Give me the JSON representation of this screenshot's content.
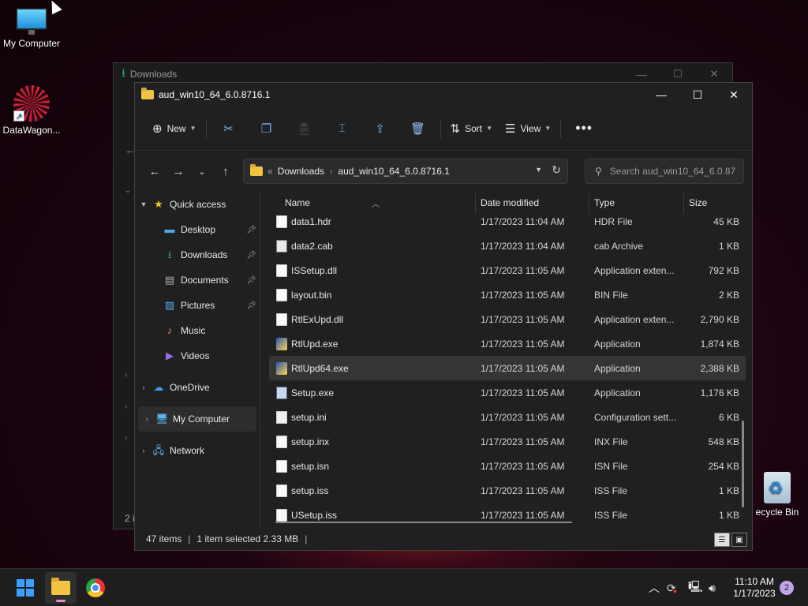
{
  "desktop": {
    "icons": [
      {
        "label": "My Computer",
        "icon": "monitor-icon"
      },
      {
        "label": "DataWagon...",
        "icon": "datawagon-icon"
      },
      {
        "label": "ecycle Bin",
        "icon": "recycle-bin-icon"
      }
    ]
  },
  "back_window": {
    "title": "Downloads",
    "status": "2 i",
    "controls": {
      "minimize": "—",
      "maximize": "☐",
      "close": "✕"
    }
  },
  "window": {
    "title": "aud_win10_64_6.0.8716.1",
    "controls": {
      "minimize": "—",
      "maximize": "☐",
      "close": "✕"
    }
  },
  "toolbar": {
    "new_label": "New",
    "sort_label": "Sort",
    "view_label": "View",
    "more_label": "•••",
    "icons": [
      "plus-icon",
      "cut-icon",
      "copy-icon",
      "paste-icon",
      "rename-icon",
      "share-icon",
      "delete-icon",
      "sort-icon",
      "view-icon",
      "more-icon"
    ]
  },
  "navigation": {
    "back": "←",
    "forward": "→",
    "recent": "⌄",
    "up": "↑",
    "breadcrumb": [
      "Downloads",
      "aud_win10_64_6.0.8716.1"
    ],
    "overflow": "«",
    "search_placeholder": "Search aud_win10_64_6.0.87..."
  },
  "sidebar": {
    "items": [
      {
        "label": "Quick access",
        "icon": "star-icon",
        "pinned": false
      },
      {
        "label": "Desktop",
        "icon": "desktop-icon",
        "pinned": true
      },
      {
        "label": "Downloads",
        "icon": "download-icon",
        "pinned": true
      },
      {
        "label": "Documents",
        "icon": "document-icon",
        "pinned": true
      },
      {
        "label": "Pictures",
        "icon": "pictures-icon",
        "pinned": true
      },
      {
        "label": "Music",
        "icon": "music-icon",
        "pinned": false
      },
      {
        "label": "Videos",
        "icon": "videos-icon",
        "pinned": false
      },
      {
        "label": "OneDrive",
        "icon": "cloud-icon",
        "pinned": false
      },
      {
        "label": "My Computer",
        "icon": "computer-icon",
        "pinned": false
      },
      {
        "label": "Network",
        "icon": "network-icon",
        "pinned": false
      }
    ]
  },
  "columns": {
    "name": "Name",
    "date": "Date modified",
    "type": "Type",
    "size": "Size"
  },
  "files": [
    {
      "name": "data1.hdr",
      "date": "1/17/2023 11:04 AM",
      "type": "HDR File",
      "size": "45 KB",
      "icon": "file"
    },
    {
      "name": "data2.cab",
      "date": "1/17/2023 11:04 AM",
      "type": "cab Archive",
      "size": "1 KB",
      "icon": "cab"
    },
    {
      "name": "ISSetup.dll",
      "date": "1/17/2023 11:05 AM",
      "type": "Application exten...",
      "size": "792 KB",
      "icon": "file"
    },
    {
      "name": "layout.bin",
      "date": "1/17/2023 11:05 AM",
      "type": "BIN File",
      "size": "2 KB",
      "icon": "file"
    },
    {
      "name": "RtlExUpd.dll",
      "date": "1/17/2023 11:05 AM",
      "type": "Application exten...",
      "size": "2,790 KB",
      "icon": "file"
    },
    {
      "name": "RtlUpd.exe",
      "date": "1/17/2023 11:05 AM",
      "type": "Application",
      "size": "1,874 KB",
      "icon": "exe"
    },
    {
      "name": "RtlUpd64.exe",
      "date": "1/17/2023 11:05 AM",
      "type": "Application",
      "size": "2,388 KB",
      "icon": "exe",
      "selected": true
    },
    {
      "name": "Setup.exe",
      "date": "1/17/2023 11:05 AM",
      "type": "Application",
      "size": "1,176 KB",
      "icon": "setup"
    },
    {
      "name": "setup.ini",
      "date": "1/17/2023 11:05 AM",
      "type": "Configuration sett...",
      "size": "6 KB",
      "icon": "ini"
    },
    {
      "name": "setup.inx",
      "date": "1/17/2023 11:05 AM",
      "type": "INX File",
      "size": "548 KB",
      "icon": "file"
    },
    {
      "name": "setup.isn",
      "date": "1/17/2023 11:05 AM",
      "type": "ISN File",
      "size": "254 KB",
      "icon": "file"
    },
    {
      "name": "setup.iss",
      "date": "1/17/2023 11:05 AM",
      "type": "ISS File",
      "size": "1 KB",
      "icon": "file"
    },
    {
      "name": "USetup.iss",
      "date": "1/17/2023 11:05 AM",
      "type": "ISS File",
      "size": "1 KB",
      "icon": "file"
    }
  ],
  "status": {
    "items": "47 items",
    "selected": "1 item selected  2.33 MB"
  },
  "taskbar": {
    "apps": [
      "windows-start-icon",
      "file-explorer-icon",
      "chrome-icon"
    ],
    "tray_icons": [
      "chevron-up-icon",
      "sync-icon",
      "network-icon",
      "volume-icon"
    ],
    "time": "11:10 AM",
    "date": "1/17/2023",
    "notification_count": "2"
  }
}
